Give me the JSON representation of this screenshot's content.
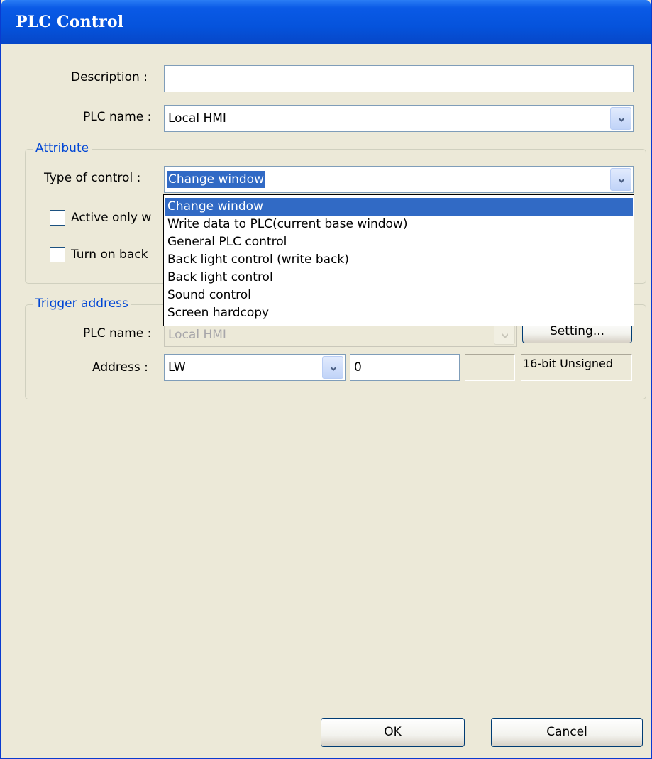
{
  "window": {
    "title": "PLC Control"
  },
  "description": {
    "label": "Description :",
    "value": ""
  },
  "plc": {
    "label": "PLC name :",
    "value": "Local HMI"
  },
  "attribute": {
    "title": "Attribute",
    "type_label": "Type of control :",
    "type_value": "Change window",
    "check1_label": "Active only w",
    "check1_checked": false,
    "check2_label": "Turn on back",
    "check2_checked": false
  },
  "dropdown": {
    "options": [
      "Change window",
      "Write data to PLC(current base window)",
      "General PLC control",
      "Back light control (write back)",
      "Back light control",
      "Sound control",
      "Screen hardcopy"
    ],
    "selected_index": 0
  },
  "trigger": {
    "title": "Trigger address",
    "plc_label": "PLC name :",
    "plc_value": "Local HMI",
    "setting_label": "Setting...",
    "address_label": "Address :",
    "device_value": "LW",
    "address_value": "0",
    "extra_value": "",
    "format_label": "16-bit Unsigned"
  },
  "buttons": {
    "ok": "OK",
    "cancel": "Cancel"
  },
  "colors": {
    "title_bar": "#0553dc",
    "face": "#ece9d8",
    "selection": "#316ac5",
    "group_title": "#0046d5"
  },
  "icons": {
    "combo_arrow": "chevron-down-icon"
  }
}
